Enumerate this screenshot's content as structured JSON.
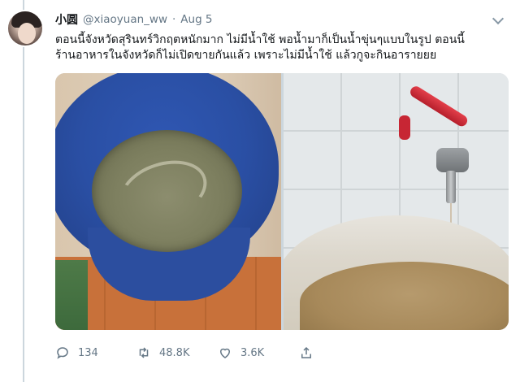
{
  "tweet": {
    "author": {
      "display_name": "小圆",
      "handle": "@xiaoyuan_ww"
    },
    "separator": "·",
    "timestamp": "Aug 5",
    "text": "ตอนนี้จังหวัดสุรินทร์วิกฤตหนักมาก ไม่มีน้ำใช้ พอน้ำมาก็เป็นน้ำขุ่นๆแบบในรูป ตอนนี้\nร้านอาหารในจังหวัดก็ไม่เปิดขายกันแล้ว เพราะไม่มีน้ำใช้ แล้วกูจะกินอารายยย",
    "actions": {
      "replies": "134",
      "retweets": "48.8K",
      "likes": "3.6K"
    }
  },
  "icons": {
    "avatar": "profile-photo",
    "more": "chevron-down-icon",
    "reply": "reply-icon",
    "retweet": "retweet-icon",
    "like": "heart-icon",
    "share": "share-icon"
  },
  "colors": {
    "text_primary": "#14171a",
    "text_secondary": "#657786",
    "thread_line": "#ccd6dd"
  }
}
